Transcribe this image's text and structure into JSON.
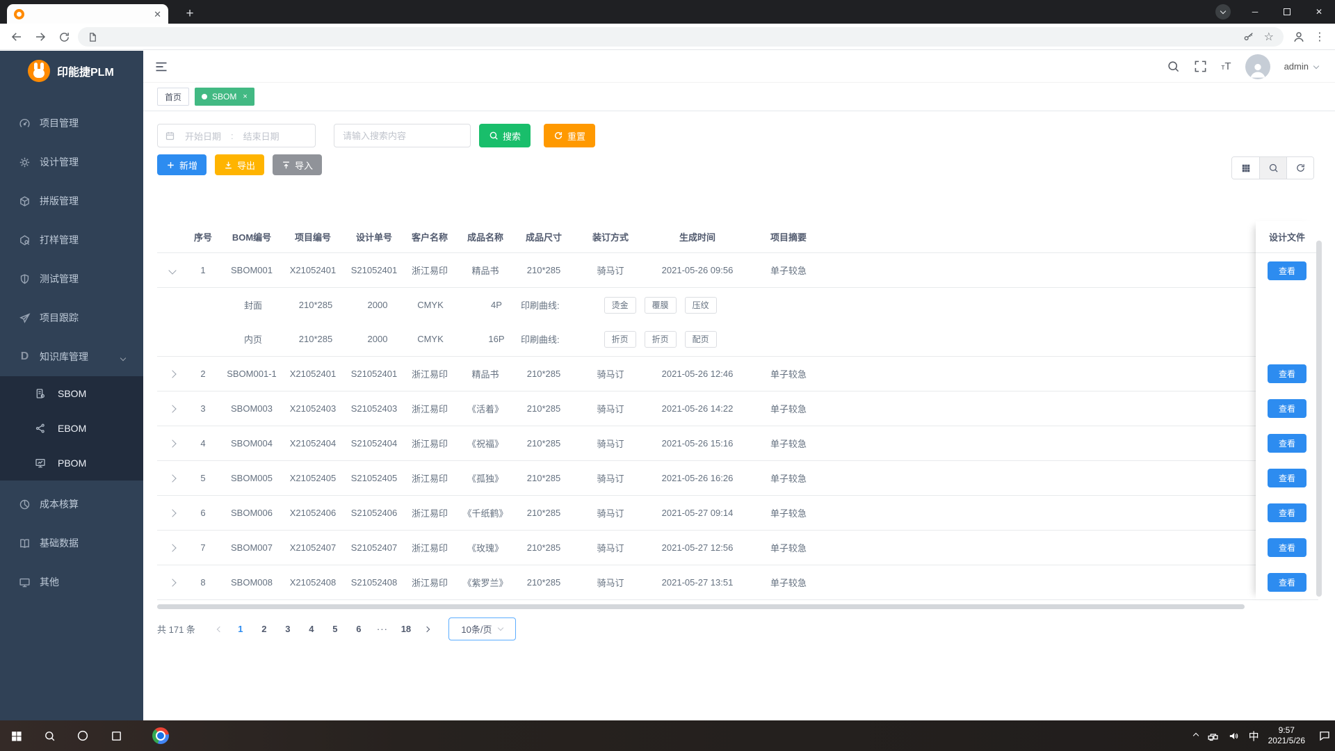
{
  "browser": {
    "tab_title": "",
    "new_tab_label": "+",
    "minimize": "─",
    "close": "✕",
    "tab_close": "✕"
  },
  "taskbar": {
    "time": "9:57",
    "date": "2021/5/26",
    "ime": "中"
  },
  "sidebar": {
    "logo_text": "印能捷PLM",
    "items": [
      {
        "label": "项目管理",
        "icon": "gauge-icon"
      },
      {
        "label": "设计管理",
        "icon": "gear-icon"
      },
      {
        "label": "拼版管理",
        "icon": "cube-icon"
      },
      {
        "label": "打样管理",
        "icon": "box-search-icon"
      },
      {
        "label": "测试管理",
        "icon": "shield-icon"
      },
      {
        "label": "项目跟踪",
        "icon": "send-icon"
      },
      {
        "label": "知识库管理",
        "icon": "letter-d-icon"
      }
    ],
    "knowledge_children": [
      {
        "label": "SBOM",
        "icon": "doc-gear-icon"
      },
      {
        "label": "EBOM",
        "icon": "share-icon"
      },
      {
        "label": "PBOM",
        "icon": "monitor-chart-icon"
      }
    ],
    "bottom_items": [
      {
        "label": "成本核算",
        "icon": "pie-icon"
      },
      {
        "label": "基础数据",
        "icon": "book-icon"
      },
      {
        "label": "其他",
        "icon": "monitor-icon"
      }
    ]
  },
  "header": {
    "user": "admin"
  },
  "tags": {
    "home": "首页",
    "active": "SBOM"
  },
  "filters": {
    "date_start": "开始日期",
    "date_separator": ":",
    "date_end": "结束日期",
    "search_placeholder": "请输入搜索内容",
    "search_btn": "搜索",
    "reset_btn": "重置"
  },
  "toolbar": {
    "add": "新增",
    "export": "导出",
    "import": "导入"
  },
  "table": {
    "headers": [
      "序号",
      "BOM编号",
      "项目编号",
      "设计单号",
      "客户名称",
      "成品名称",
      "成品尺寸",
      "装订方式",
      "生成时间",
      "项目摘要"
    ],
    "fixed_header": "设计文件",
    "view_btn": "查看",
    "rows": [
      {
        "no": "1",
        "bom": "SBOM001",
        "project_no": "X21052401",
        "design_no": "S21052401",
        "customer": "浙江易印",
        "product": "精品书",
        "size": "210*285",
        "binding": "骑马订",
        "created": "2021-05-26 09:56",
        "summary": "单子较急"
      },
      {
        "no": "2",
        "bom": "SBOM001-1",
        "project_no": "X21052401",
        "design_no": "S21052401",
        "customer": "浙江易印",
        "product": "精品书",
        "size": "210*285",
        "binding": "骑马订",
        "created": "2021-05-26 12:46",
        "summary": "单子较急"
      },
      {
        "no": "3",
        "bom": "SBOM003",
        "project_no": "X21052403",
        "design_no": "S21052403",
        "customer": "浙江易印",
        "product": "《活着》",
        "size": "210*285",
        "binding": "骑马订",
        "created": "2021-05-26 14:22",
        "summary": "单子较急"
      },
      {
        "no": "4",
        "bom": "SBOM004",
        "project_no": "X21052404",
        "design_no": "S21052404",
        "customer": "浙江易印",
        "product": "《祝福》",
        "size": "210*285",
        "binding": "骑马订",
        "created": "2021-05-26 15:16",
        "summary": "单子较急"
      },
      {
        "no": "5",
        "bom": "SBOM005",
        "project_no": "X21052405",
        "design_no": "S21052405",
        "customer": "浙江易印",
        "product": "《孤独》",
        "size": "210*285",
        "binding": "骑马订",
        "created": "2021-05-26 16:26",
        "summary": "单子较急"
      },
      {
        "no": "6",
        "bom": "SBOM006",
        "project_no": "X21052406",
        "design_no": "S21052406",
        "customer": "浙江易印",
        "product": "《千纸鹤》",
        "size": "210*285",
        "binding": "骑马订",
        "created": "2021-05-27 09:14",
        "summary": "单子较急"
      },
      {
        "no": "7",
        "bom": "SBOM007",
        "project_no": "X21052407",
        "design_no": "S21052407",
        "customer": "浙江易印",
        "product": "《玫瑰》",
        "size": "210*285",
        "binding": "骑马订",
        "created": "2021-05-27 12:56",
        "summary": "单子较急"
      },
      {
        "no": "8",
        "bom": "SBOM008",
        "project_no": "X21052408",
        "design_no": "S21052408",
        "customer": "浙江易印",
        "product": "《紫罗兰》",
        "size": "210*285",
        "binding": "骑马订",
        "created": "2021-05-27 13:51",
        "summary": "单子较急"
      }
    ],
    "subrows": [
      {
        "part": "封面",
        "size": "210*285",
        "qty": "2000",
        "color": "CMYK",
        "pages": "4P",
        "curve_label": "印刷曲线:",
        "tags": [
          "烫金",
          "覆膜",
          "压纹"
        ]
      },
      {
        "part": "内页",
        "size": "210*285",
        "qty": "2000",
        "color": "CMYK",
        "pages": "16P",
        "curve_label": "印刷曲线:",
        "tags": [
          "折页",
          "折页",
          "配页"
        ]
      }
    ]
  },
  "pagination": {
    "total": "共 171 条",
    "pages": [
      "1",
      "2",
      "3",
      "4",
      "5",
      "6",
      "···",
      "18"
    ],
    "page_size": "10条/页"
  }
}
